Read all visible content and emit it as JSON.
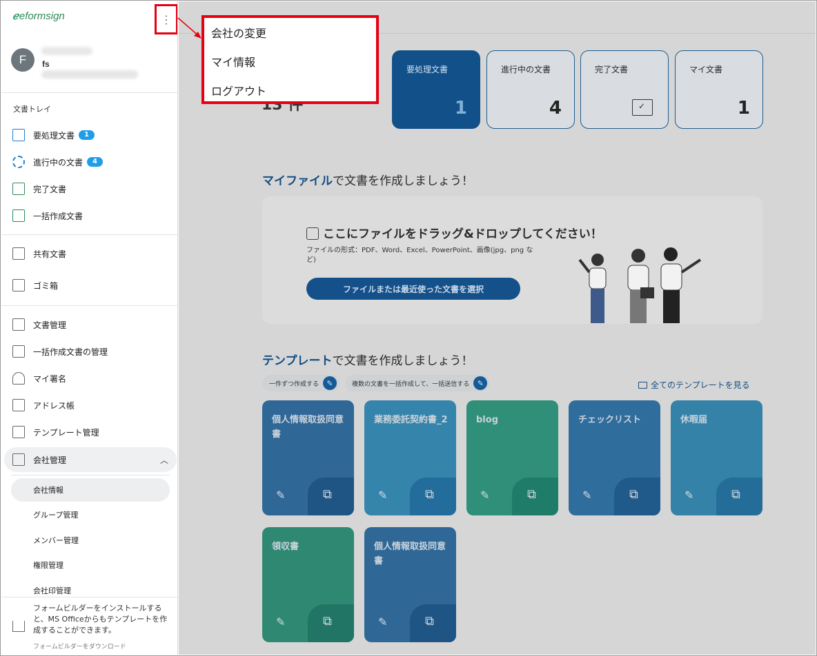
{
  "sidebar": {
    "logo": "eformsign",
    "user": {
      "initial": "F",
      "name": "fs"
    },
    "section_label": "文書トレイ",
    "tray": [
      {
        "label": "要処理文書",
        "badge": "1"
      },
      {
        "label": "進行中の文書",
        "badge": "4"
      },
      {
        "label": "完了文書"
      },
      {
        "label": "一括作成文書"
      }
    ],
    "shared": [
      {
        "label": "共有文書"
      },
      {
        "label": "ゴミ箱"
      }
    ],
    "manage": [
      {
        "label": "文書管理"
      },
      {
        "label": "一括作成文書の管理"
      },
      {
        "label": "マイ署名"
      },
      {
        "label": "アドレス帳"
      },
      {
        "label": "テンプレート管理"
      },
      {
        "label": "会社管理"
      }
    ],
    "company_sub": [
      {
        "label": "会社情報"
      },
      {
        "label": "グループ管理"
      },
      {
        "label": "メンバー管理"
      },
      {
        "label": "権限管理"
      },
      {
        "label": "会社印管理"
      }
    ],
    "footer": {
      "text": "フォームビルダーをインストールすると、MS Officeからもテンプレートを作成することができます。",
      "link": "フォームビルダーをダウンロード"
    }
  },
  "main": {
    "count": "13 件",
    "cards": [
      {
        "label": "要処理文書",
        "value": "1"
      },
      {
        "label": "進行中の文書",
        "value": "4"
      },
      {
        "label": "完了文書"
      },
      {
        "label": "マイ文書",
        "value": "1"
      }
    ],
    "myfile": {
      "heading_hl": "マイファイル",
      "heading_rest": "で文書を作成しましょう！",
      "drop_title": "ここにファイルをドラッグ&ドロップしてください！",
      "drop_sub": "ファイルの形式：PDF、Word、Excel、PowerPoint、画像(jpg、png など)",
      "button": "ファイルまたは最近使った文書を選択"
    },
    "template": {
      "heading_hl": "テンプレート",
      "heading_rest": "で文書を作成しましょう！",
      "tab1": "一件ずつ作成する",
      "tab2": "複数の文書を一括作成して、一括送信する",
      "see_all": "全てのテンプレートを見る",
      "cards": [
        {
          "name": "個人情報取扱同意書"
        },
        {
          "name": "業務委託契約書_2"
        },
        {
          "name": "blog"
        },
        {
          "name": "チェックリスト"
        },
        {
          "name": "休暇届"
        },
        {
          "name": "領収書"
        },
        {
          "name": "個人情報取扱同意書"
        }
      ]
    }
  },
  "menu": {
    "items": [
      {
        "label": "会社の変更"
      },
      {
        "label": "マイ情報"
      },
      {
        "label": "ログアウト"
      }
    ]
  },
  "colors": {
    "brand": "#12508a",
    "highlight": "#e60012",
    "badge": "#1e9ee8"
  }
}
